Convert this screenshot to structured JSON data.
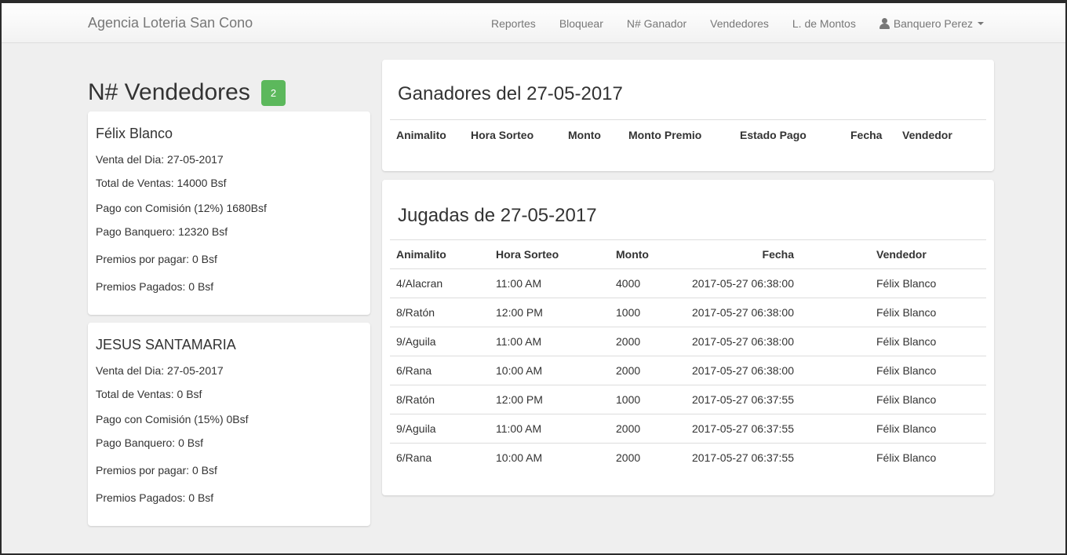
{
  "navbar": {
    "brand": "Agencia Loteria San Cono",
    "links": [
      "Reportes",
      "Bloquear",
      "N# Ganador",
      "Vendedores",
      "L. de Montos"
    ],
    "user": "Banquero Perez"
  },
  "vendors_section": {
    "title": "N# Vendedores",
    "count": "2",
    "vendors": [
      {
        "name": "Félix Blanco",
        "venta_dia": "Venta del Dia: 27-05-2017",
        "total_ventas": "Total de Ventas: 14000 Bsf",
        "pago_comision": "Pago con Comisión (12%) 1680Bsf",
        "pago_banquero": "Pago Banquero: 12320 Bsf",
        "premios_por_pagar": "Premios por pagar: 0 Bsf",
        "premios_pagados": "Premios Pagados: 0 Bsf"
      },
      {
        "name": "JESUS SANTAMARIA",
        "venta_dia": "Venta del Dia: 27-05-2017",
        "total_ventas": "Total de Ventas: 0 Bsf",
        "pago_comision": "Pago con Comisión (15%) 0Bsf",
        "pago_banquero": "Pago Banquero: 0 Bsf",
        "premios_por_pagar": "Premios por pagar: 0 Bsf",
        "premios_pagados": "Premios Pagados: 0 Bsf"
      }
    ]
  },
  "ganadores": {
    "title": "Ganadores del 27-05-2017",
    "columns": [
      "Animalito",
      "Hora Sorteo",
      "Monto",
      "Monto Premio",
      "Estado Pago",
      "Fecha",
      "Vendedor"
    ]
  },
  "jugadas": {
    "title": "Jugadas de 27-05-2017",
    "columns": [
      "Animalito",
      "Hora Sorteo",
      "Monto",
      "Fecha",
      "Vendedor"
    ],
    "rows": [
      [
        "4/Alacran",
        "11:00 AM",
        "4000",
        "2017-05-27 06:38:00",
        "Félix Blanco"
      ],
      [
        "8/Ratón",
        "12:00 PM",
        "1000",
        "2017-05-27 06:38:00",
        "Félix Blanco"
      ],
      [
        "9/Aguila",
        "11:00 AM",
        "2000",
        "2017-05-27 06:38:00",
        "Félix Blanco"
      ],
      [
        "6/Rana",
        "10:00 AM",
        "2000",
        "2017-05-27 06:38:00",
        "Félix Blanco"
      ],
      [
        "8/Ratón",
        "12:00 PM",
        "1000",
        "2017-05-27 06:37:55",
        "Félix Blanco"
      ],
      [
        "9/Aguila",
        "11:00 AM",
        "2000",
        "2017-05-27 06:37:55",
        "Félix Blanco"
      ],
      [
        "6/Rana",
        "10:00 AM",
        "2000",
        "2017-05-27 06:37:55",
        "Félix Blanco"
      ]
    ]
  },
  "colors": {
    "badge": "#5cb85c",
    "nav_text": "#777777",
    "background": "#efefef"
  }
}
